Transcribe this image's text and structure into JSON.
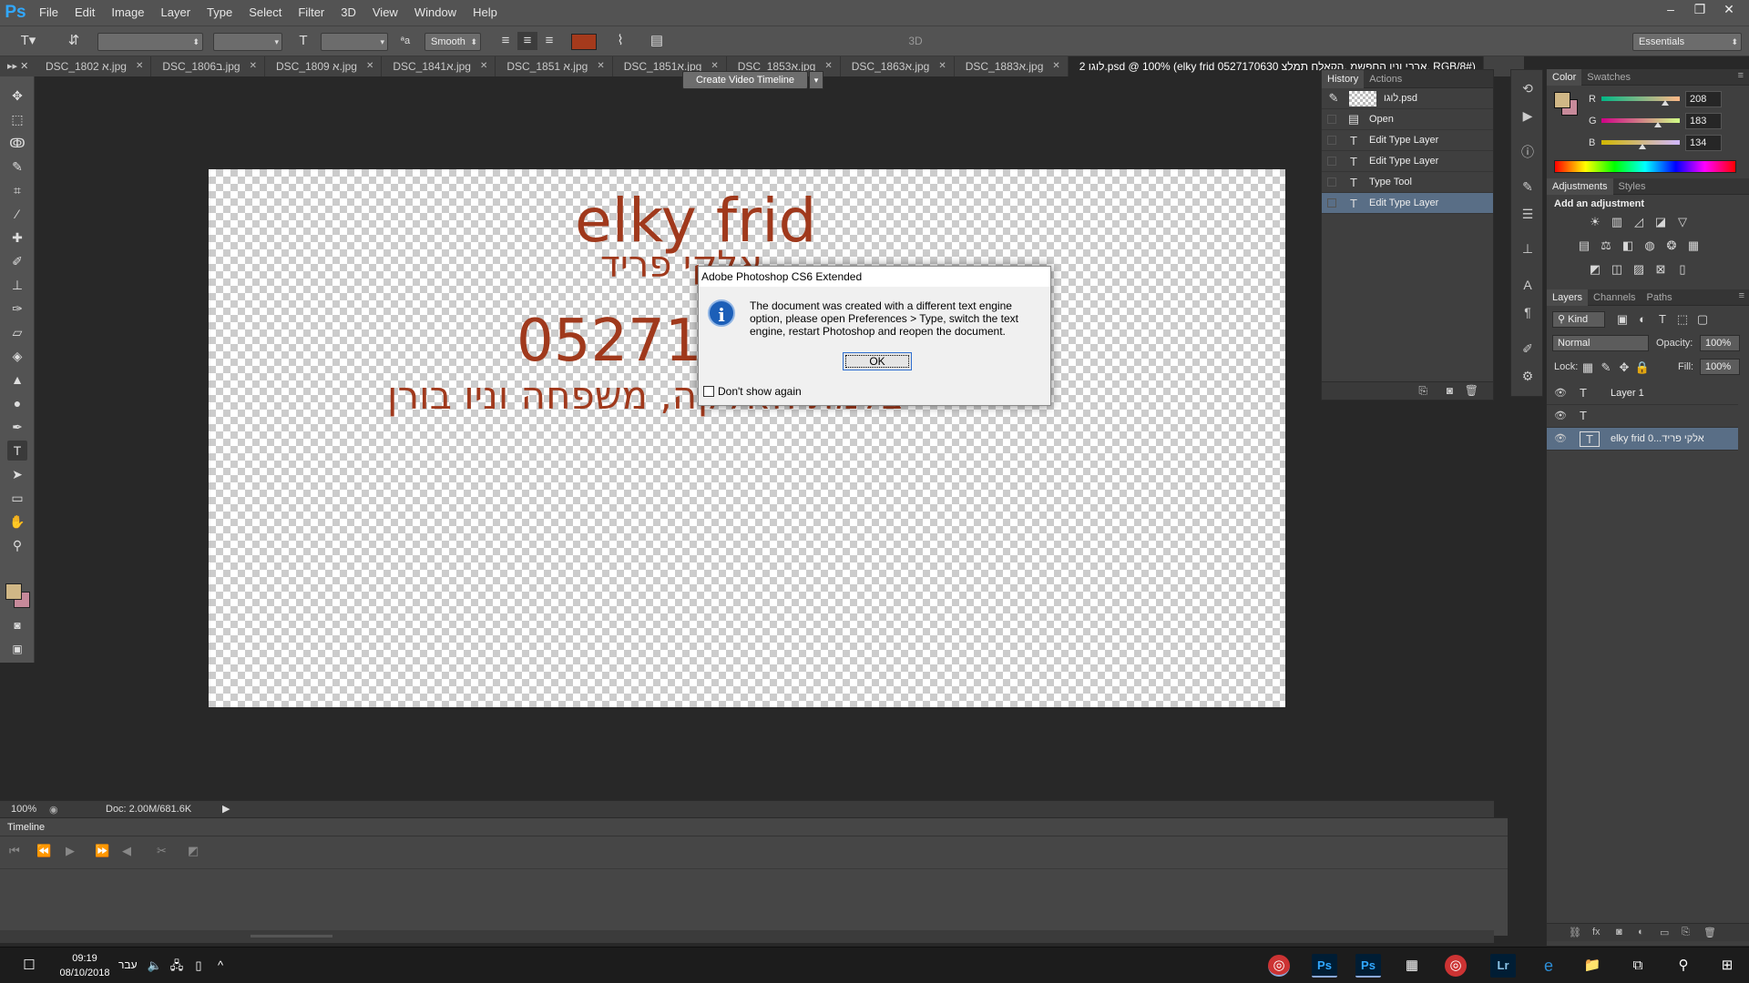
{
  "app": {
    "logo": "Ps"
  },
  "menu": [
    "File",
    "Edit",
    "Image",
    "Layer",
    "Type",
    "Select",
    "Filter",
    "3D",
    "View",
    "Window",
    "Help"
  ],
  "window_controls": [
    "–",
    "❐",
    "✕"
  ],
  "options": {
    "antialias": "Smooth",
    "workspace": "Essentials",
    "mode_3d": "3D",
    "text_color": "#a53a1c"
  },
  "tabs": [
    {
      "label": "DSC_1802 א.jpg",
      "active": false
    },
    {
      "label": "DSC_1806ב.jpg",
      "active": false
    },
    {
      "label": "DSC_1809 א.jpg",
      "active": false
    },
    {
      "label": "DSC_1841א.jpg",
      "active": false
    },
    {
      "label": "DSC_1851 א.jpg",
      "active": false
    },
    {
      "label": "DSC_1851א.jpg",
      "active": false
    },
    {
      "label": "DSC_1853א.jpg",
      "active": false
    },
    {
      "label": "DSC_1863א.jpg",
      "active": false
    },
    {
      "label": "DSC_1883א.jpg",
      "active": false
    },
    {
      "label": "2 לוגו.psd @ 100% (elky frid  0527170630 ארבי וניו החפשמ ,הקאלח תמלצ, RGB/8#)",
      "active": true
    }
  ],
  "artwork": {
    "line1": "elky frid",
    "line2": "אלקי פריד",
    "line3": "0527170630",
    "line4": "צלמת חאלקה, משפחה וניו בורן",
    "color": "#a0391c"
  },
  "dialog": {
    "title": "Adobe Photoshop CS6 Extended",
    "message": "The document was created with a different text engine option, please open Preferences > Type, switch the text engine, restart Photoshop and reopen the document.",
    "ok_label": "OK",
    "checkbox_label": "Don't show again"
  },
  "status": {
    "zoom": "100%",
    "doc": "Doc: 2.00M/681.6K"
  },
  "timeline": {
    "title": "Timeline",
    "create_label": "Create Video Timeline"
  },
  "history": {
    "tabs": [
      "History",
      "Actions"
    ],
    "snapshot": "לוגו.psd",
    "items": [
      "Open",
      "Edit Type Layer",
      "Edit Type Layer",
      "Type Tool",
      "Edit Type Layer"
    ]
  },
  "color_panel": {
    "tabs": [
      "Color",
      "Swatches"
    ],
    "r_label": "R",
    "g_label": "G",
    "b_label": "B",
    "r": "208",
    "g": "183",
    "b": "134",
    "r_level": 0.816,
    "g_level": 0.718,
    "b_level": 0.525,
    "fg": "#d0b786",
    "bg": "#c78a9a"
  },
  "adjustments": {
    "tabs": [
      "Adjustments",
      "Styles"
    ],
    "heading": "Add an adjustment"
  },
  "layers": {
    "tabs": [
      "Layers",
      "Channels",
      "Paths"
    ],
    "filter": "Kind",
    "blend": "Normal",
    "opacity_label": "Opacity:",
    "opacity": "100%",
    "lock_label": "Lock:",
    "fill_label": "Fill:",
    "fill": "100%",
    "items": [
      {
        "name": "Layer 1",
        "selected": false
      },
      {
        "name": "",
        "selected": false
      },
      {
        "name": "elky frid  0...אלקי פריד",
        "selected": true
      }
    ]
  },
  "taskbar": {
    "time": "09:19",
    "date": "08/10/2018",
    "lang": "עבר"
  }
}
